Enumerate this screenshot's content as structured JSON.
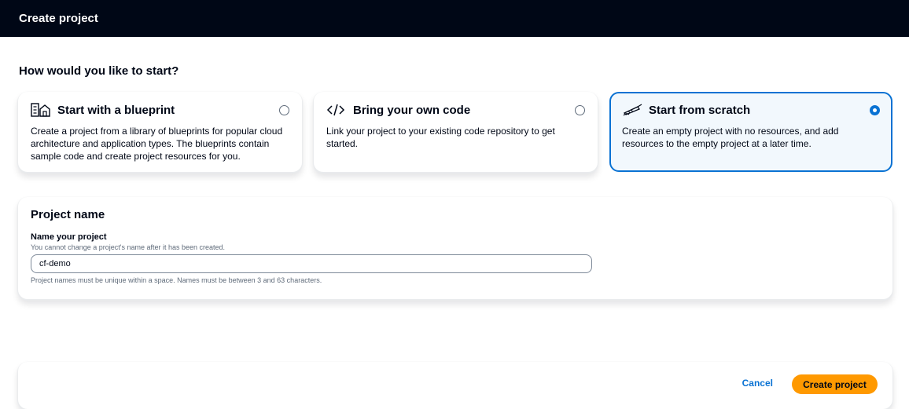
{
  "header": {
    "title": "Create project"
  },
  "start": {
    "question": "How would you like to start?",
    "options": [
      {
        "title": "Start with a blueprint",
        "description": "Create a project from a library of blueprints for popular cloud architecture and application types. The blueprints contain sample code and create project resources for you.",
        "icon": "blueprint-icon",
        "selected": false
      },
      {
        "title": "Bring your own code",
        "description": "Link your project to your existing code repository to get started.",
        "icon": "code-icon",
        "selected": false
      },
      {
        "title": "Start from scratch",
        "description": "Create an empty project with no resources, and add resources to the empty project at a later time.",
        "icon": "pen-icon",
        "selected": true
      }
    ]
  },
  "project_name": {
    "section_title": "Project name",
    "label": "Name your project",
    "description": "You cannot change a project's name after it has been created.",
    "value": "cf-demo",
    "constraint": "Project names must be unique within a space. Names must be between 3 and 63 characters."
  },
  "footer": {
    "cancel_label": "Cancel",
    "create_label": "Create project"
  },
  "colors": {
    "header_bg": "#000716",
    "accent": "#0972d3",
    "primary_button": "#ff9900",
    "selected_bg": "#f2f8fd"
  }
}
